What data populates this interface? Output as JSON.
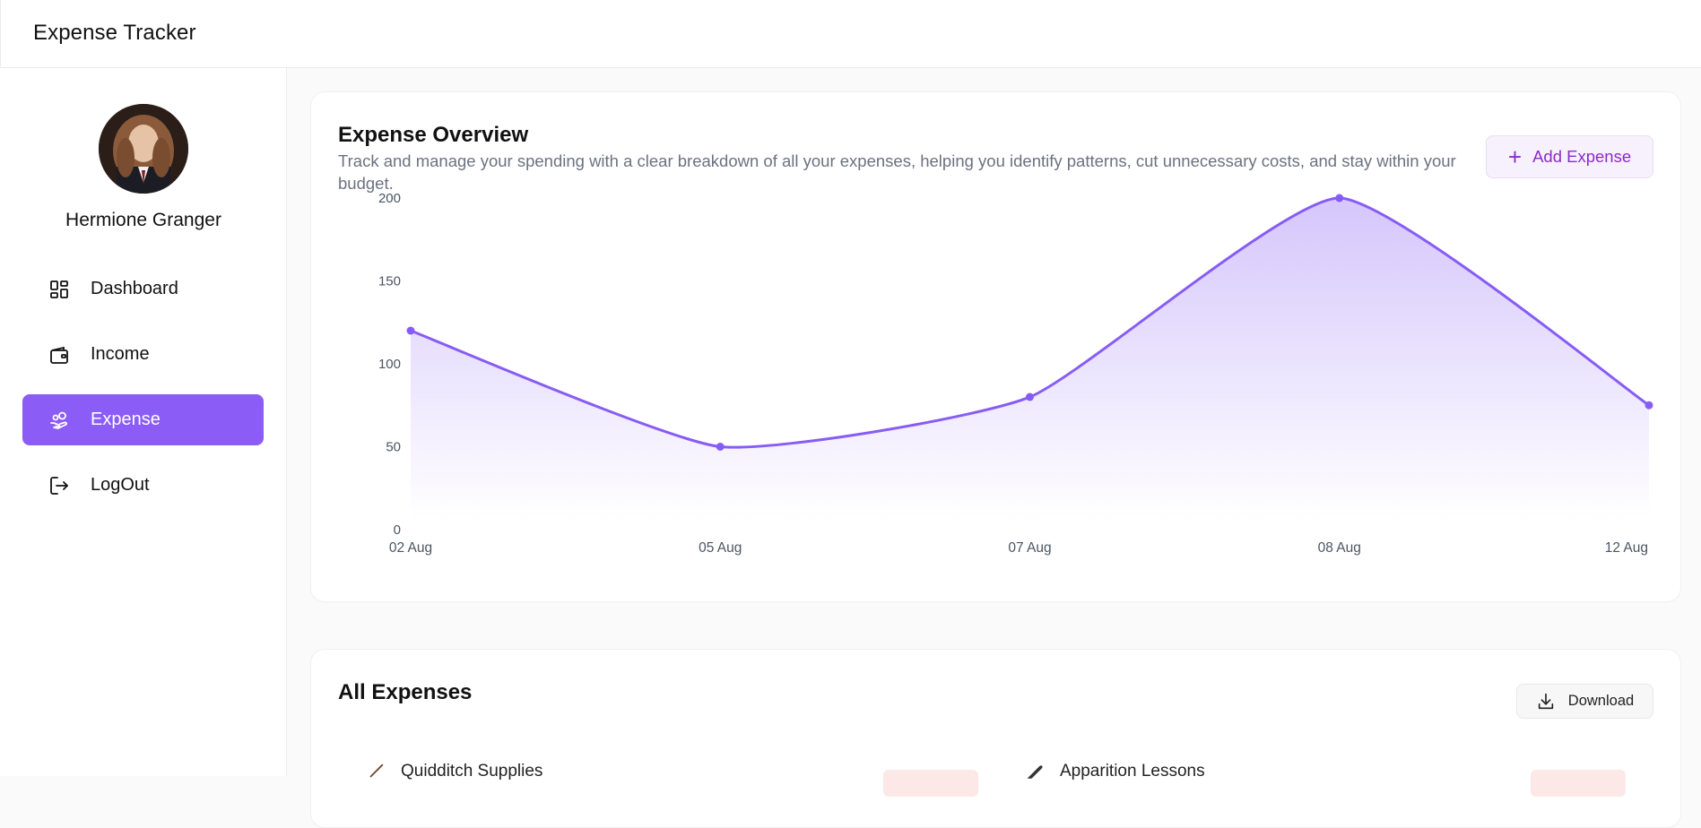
{
  "app": {
    "title": "Expense Tracker"
  },
  "sidebar": {
    "user_name": "Hermione Granger",
    "items": [
      {
        "label": "Dashboard",
        "icon": "dashboard-icon",
        "active": false
      },
      {
        "label": "Income",
        "icon": "wallet-icon",
        "active": false
      },
      {
        "label": "Expense",
        "icon": "hand-coins-icon",
        "active": true
      },
      {
        "label": "LogOut",
        "icon": "logout-icon",
        "active": false
      }
    ]
  },
  "overview": {
    "title": "Expense Overview",
    "description": "Track and manage your spending with a clear breakdown of all your expenses, helping you identify patterns, cut unnecessary costs, and stay within your budget.",
    "add_button": "Add Expense",
    "add_icon": "plus-icon"
  },
  "chart_data": {
    "type": "area",
    "title": "",
    "xlabel": "",
    "ylabel": "",
    "categories": [
      "02 Aug",
      "05 Aug",
      "07 Aug",
      "08 Aug",
      "12 Aug"
    ],
    "series": [
      {
        "values": [
          120,
          50,
          80,
          200,
          75
        ],
        "color": "#875cf5"
      }
    ],
    "yticks": [
      0,
      50,
      100,
      150,
      200
    ],
    "ylim": [
      0,
      200
    ],
    "grid": false,
    "legend": "none"
  },
  "expenses": {
    "title": "All Expenses",
    "download_button": "Download",
    "download_icon": "download-icon",
    "items": [
      {
        "name": "Quidditch Supplies",
        "icon": "broom-icon"
      },
      {
        "name": "Apparition Lessons",
        "icon": "feather-icon"
      }
    ]
  },
  "colors": {
    "accent": "#8b5cf6",
    "accent_text": "#8b2cc9",
    "line": "#875cf5"
  }
}
